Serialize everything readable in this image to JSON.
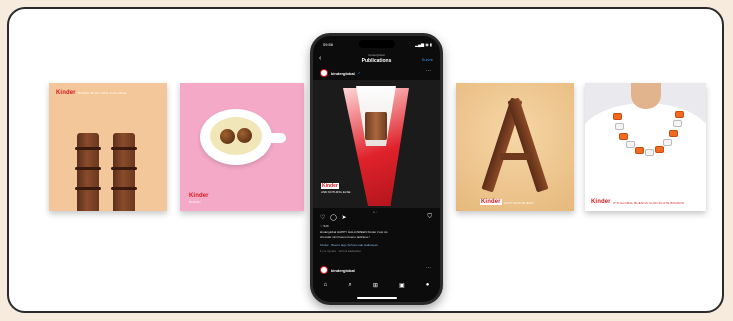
{
  "tiles": [
    {
      "brand": "Kinder",
      "caption": "BUENO BLUE NOW AVAILABLE"
    },
    {
      "brand": "Kinder",
      "caption": "BUENO"
    },
    {
      "brand": "Kinder",
      "caption": "ANYTHING BUENO"
    },
    {
      "brand": "Kinder",
      "caption": "IT'S GLOBAL BUENOS CHOCOLATE BRANDS"
    }
  ],
  "phone": {
    "time": "09:56",
    "signal": "▂▄▆ ◉ ▮",
    "header_sub": "kinderglobal",
    "header_title": "Publications",
    "header_action": "Suivre",
    "username": "kinderglobal",
    "verified": "✔",
    "post_brand": "Kinder",
    "post_tag": "AND NOTHING ELSE",
    "likes": "♡ 520",
    "caption_1": "kinderglobal HAPPY HALLOWEEN Kinder c'est du",
    "caption_2": "chocolat mini bueno bueno delicieux !",
    "caption_3": "Kinder · Bueno tagu Schoco tale Halloween",
    "caption_4": "il y a 4 jours · Voir la traduction",
    "username_2": "kinderglobal"
  },
  "colors": {
    "brand_red": "#d71920",
    "page_bg": "#f7ebdd"
  }
}
